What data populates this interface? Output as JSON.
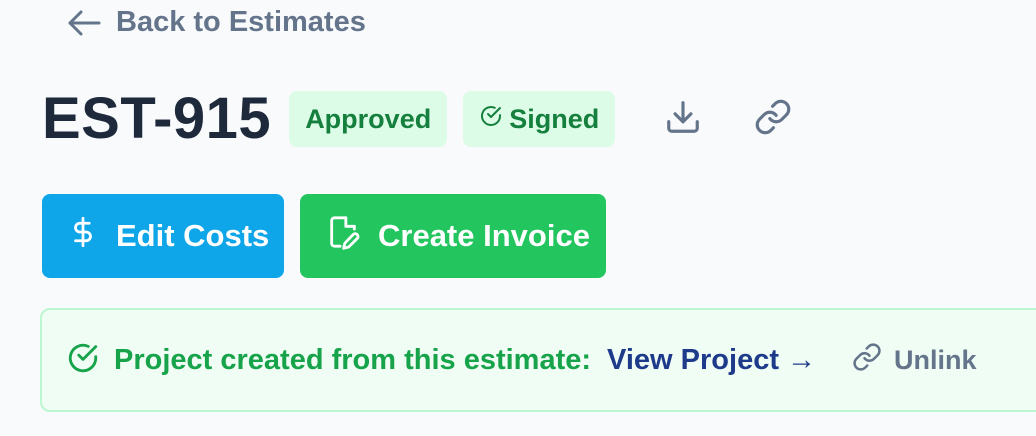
{
  "nav": {
    "back_label": "Back to Estimates"
  },
  "estimate": {
    "id": "EST-915",
    "status_badge": "Approved",
    "signed_badge": "Signed"
  },
  "actions": {
    "edit_costs_label": "Edit Costs",
    "create_invoice_label": "Create Invoice"
  },
  "banner": {
    "message": "Project created from this estimate:",
    "link_label": "View Project →",
    "unlink_label": "Unlink"
  },
  "icons": {
    "back": "arrow-left-icon",
    "signed": "check-circle-icon",
    "download": "download-icon",
    "copy_link": "link-icon",
    "edit_costs": "dollar-icon",
    "create_invoice": "file-edit-icon",
    "banner": "check-circle-icon",
    "unlink": "link-icon"
  },
  "colors": {
    "primary_blue": "#0ea5e9",
    "success_green": "#22c55e",
    "badge_bg": "#dcfce7",
    "badge_text": "#15803d",
    "link_navy": "#1e3a8a",
    "muted": "#64748b"
  }
}
